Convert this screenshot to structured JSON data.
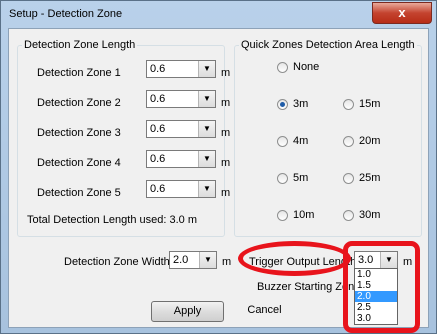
{
  "window": {
    "title": "Setup - Detection Zone",
    "close_glyph": "x"
  },
  "length_group": {
    "legend": "Detection Zone Length",
    "zones": [
      {
        "label": "Detection Zone 1",
        "value": "0.6",
        "unit": "m"
      },
      {
        "label": "Detection Zone 2",
        "value": "0.6",
        "unit": "m"
      },
      {
        "label": "Detection Zone 3",
        "value": "0.6",
        "unit": "m"
      },
      {
        "label": "Detection Zone 4",
        "value": "0.6",
        "unit": "m"
      },
      {
        "label": "Detection Zone 5",
        "value": "0.6",
        "unit": "m"
      }
    ],
    "total_text": "Total Detection Length used: 3.0 m"
  },
  "quick_group": {
    "legend": "Quick Zones Detection Area Length",
    "none_label": "None",
    "options": [
      "3m",
      "15m",
      "4m",
      "20m",
      "5m",
      "25m",
      "10m",
      "30m"
    ],
    "selected": "3m"
  },
  "width_row": {
    "label": "Detection Zone Width:",
    "value": "2.0",
    "unit": "m"
  },
  "trigger_row": {
    "label": "Trigger Output Length",
    "value": "3.0",
    "unit": "m"
  },
  "buzzer_label": "Buzzer Starting Zone",
  "dropdown_options": [
    "1.0",
    "1.5",
    "2.0",
    "2.5",
    "3.0"
  ],
  "dropdown_selected": "2.0",
  "buttons": {
    "apply": "Apply",
    "cancel": "Cancel"
  },
  "colors": {
    "annotation": "#e8141c",
    "selection": "#3399ff",
    "accent": "#1e5ca8"
  }
}
